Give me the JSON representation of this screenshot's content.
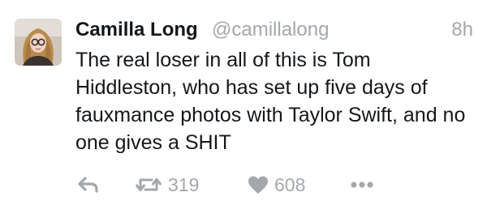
{
  "tweet": {
    "author_name": "Camilla Long",
    "author_handle": "@camillalong",
    "timestamp": "8h",
    "text": "The real loser in all of this is Tom Hiddleston, who has set up five days of fauxmance photos with Taylor Swift, and no one gives a SHIT",
    "retweet_count": "319",
    "like_count": "608"
  },
  "icons": {
    "reply": "reply-icon",
    "retweet": "retweet-icon",
    "like": "heart-icon",
    "more": "more-icon"
  },
  "colors": {
    "text": "#14171a",
    "muted": "#a4a7ab",
    "background": "#ffffff"
  }
}
